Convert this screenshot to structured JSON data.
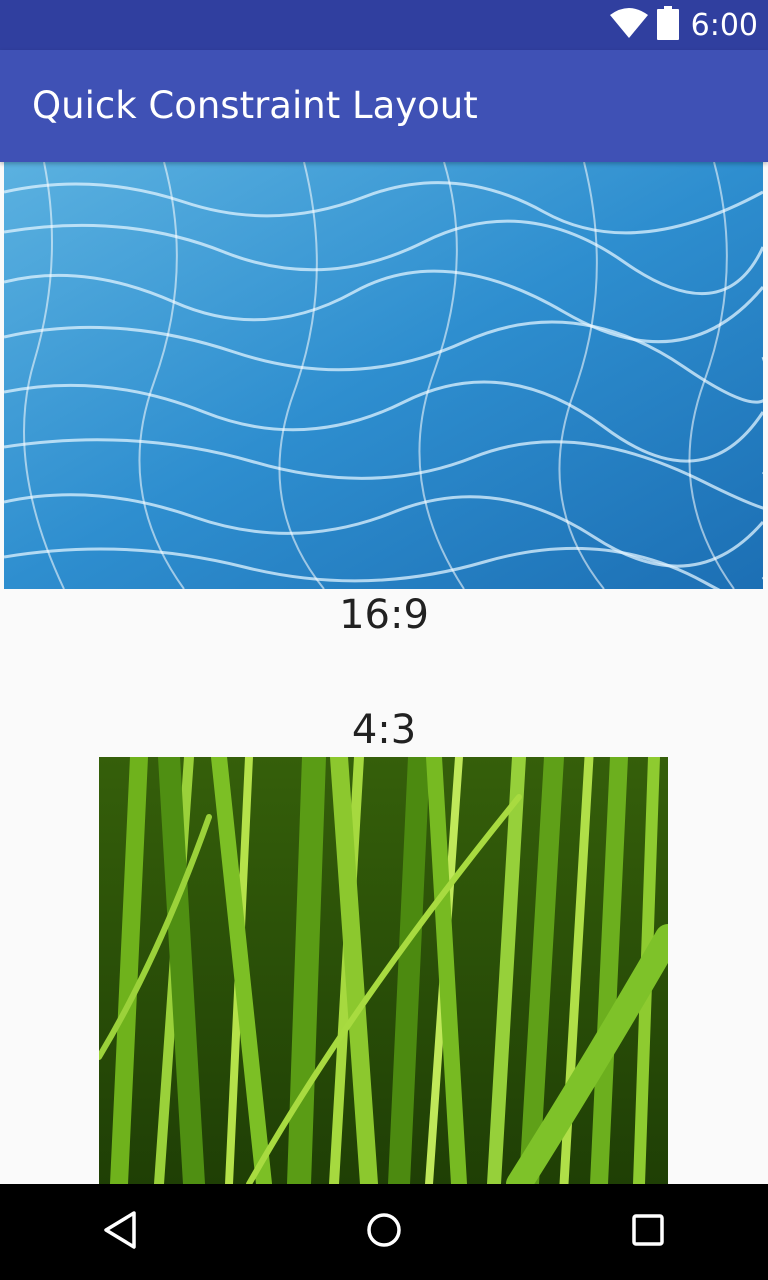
{
  "status_bar": {
    "time": "6:00",
    "icons": [
      "wifi-icon",
      "battery-icon"
    ],
    "color": "#303f9f"
  },
  "app_bar": {
    "title": "Quick Constraint Layout",
    "color": "#3f51b5"
  },
  "content": {
    "images": [
      {
        "name": "water",
        "ratio_label": "16:9"
      },
      {
        "name": "grass",
        "ratio_label": "4:3"
      }
    ]
  },
  "nav_bar": {
    "buttons": [
      "back-icon",
      "home-icon",
      "recents-icon"
    ],
    "color": "#000000"
  }
}
